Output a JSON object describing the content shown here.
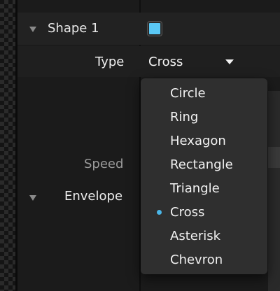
{
  "panel": {
    "shape_label": "Shape 1",
    "shape_color": "#5ac8f5",
    "type_label": "Type",
    "type_value": "Cross",
    "speed_label": "Speed",
    "envelope_label": "Envelope"
  },
  "menu": {
    "selected": "Cross",
    "selected_indicator_color": "#4ab6e8",
    "items": [
      {
        "label": "Circle"
      },
      {
        "label": "Ring"
      },
      {
        "label": "Hexagon"
      },
      {
        "label": "Rectangle"
      },
      {
        "label": "Triangle"
      },
      {
        "label": "Cross"
      },
      {
        "label": "Asterisk"
      },
      {
        "label": "Chevron"
      }
    ]
  }
}
